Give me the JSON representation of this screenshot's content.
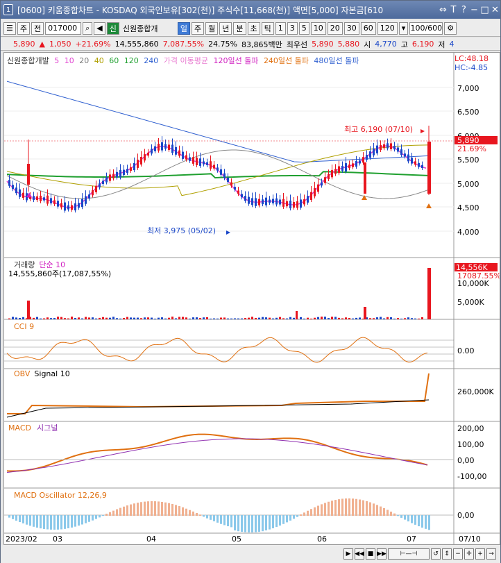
{
  "title": {
    "num": "1",
    "text": "[0600] 키움종합차트 - KOSDAQ 외국인보유[302(천)] 주식수[11,668(천)] 액면[5,000] 자본금[610"
  },
  "toolbar": {
    "market": "주",
    "type": "전",
    "code": "017000",
    "name": "신원종합개",
    "periods": [
      "일",
      "주",
      "월",
      "년",
      "분",
      "초",
      "틱"
    ],
    "nums": [
      "1",
      "3",
      "5",
      "10",
      "20",
      "30",
      "60",
      "120"
    ],
    "count": "100/600"
  },
  "info": {
    "price": "5,890",
    "change": "1,050",
    "pct": "+21.69%",
    "volume": "14,555,860",
    "vol_pct": "7,087.55%",
    "turnover": "24.75%",
    "amount": "83,865백만",
    "best_label": "최우선",
    "best1": "5,890",
    "best2": "5,880",
    "open_label": "시",
    "open": "4,770",
    "high_label": "고",
    "high": "6,190",
    "low_label": "저",
    "low": "4"
  },
  "price_panel": {
    "legend": [
      "신원종합개발",
      "5",
      "10",
      "20",
      "40",
      "60",
      "120",
      "240",
      "가격 이동평균",
      "120일선 돌파",
      "240일선 돌파",
      "480일선 돌파"
    ],
    "lc": "LC:48.18",
    "hc": "HC:-4.85",
    "high_note": "최고 6,190 (07/10)",
    "low_note": "최저 3,975 (05/02)",
    "cur_price": "5,890",
    "cur_pct": "21.69%",
    "yticks": [
      "7,000",
      "6,500",
      "6,000",
      "5,500",
      "5,000",
      "4,500",
      "4,000"
    ]
  },
  "volume_panel": {
    "title": "거래량",
    "ma": "단순 10",
    "value": "14,555,860주(17,087,55%)",
    "cur": "14,556K",
    "cur_pct": "17087.55%",
    "yticks": [
      "10,000K",
      "5,000K"
    ]
  },
  "cci_panel": {
    "title": "CCI 9",
    "ytick": "0.00"
  },
  "obv_panel": {
    "title": "OBV",
    "signal": "Signal 10",
    "ytick": "260,000K"
  },
  "macd_panel": {
    "title": "MACD",
    "signal": "시그널",
    "yticks": [
      "200,00",
      "100,00",
      "0,00",
      "-100,00"
    ]
  },
  "osc_panel": {
    "title": "MACD Oscillator 12,26,9",
    "ytick": "0,00"
  },
  "xaxis": [
    "2023/02",
    "03",
    "04",
    "05",
    "06",
    "07",
    "07/10"
  ],
  "colors": {
    "up": "#e8161f",
    "down": "#1a47c8",
    "accent": "#3d7ad6"
  }
}
